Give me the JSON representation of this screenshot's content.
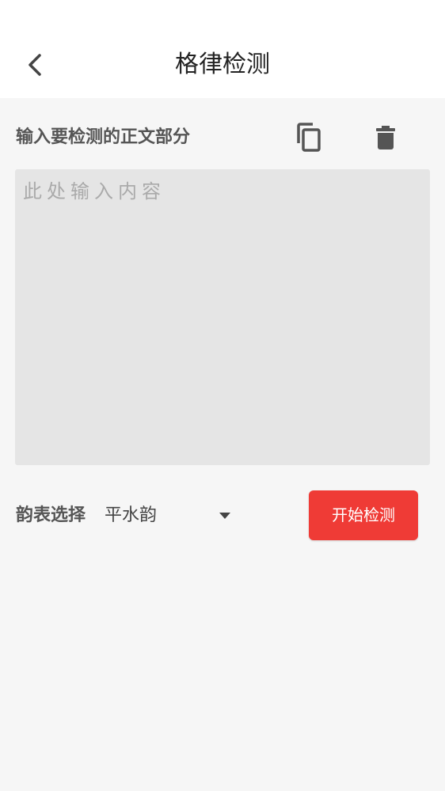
{
  "header": {
    "title": "格律检测",
    "back_icon": "chevron-left-icon"
  },
  "editor": {
    "label": "输入要检测的正文部分",
    "copy_icon": "copy-icon",
    "delete_icon": "trash-icon",
    "input_value": "",
    "input_placeholder": "此处输入内容"
  },
  "rhyme": {
    "label": "韵表选择",
    "selected": "平水韵",
    "arrow_icon": "dropdown-arrow-icon"
  },
  "actions": {
    "start_label": "开始检测"
  },
  "colors": {
    "accent": "#ef3b36",
    "background": "#f6f6f6",
    "input_background": "#e5e5e5"
  }
}
